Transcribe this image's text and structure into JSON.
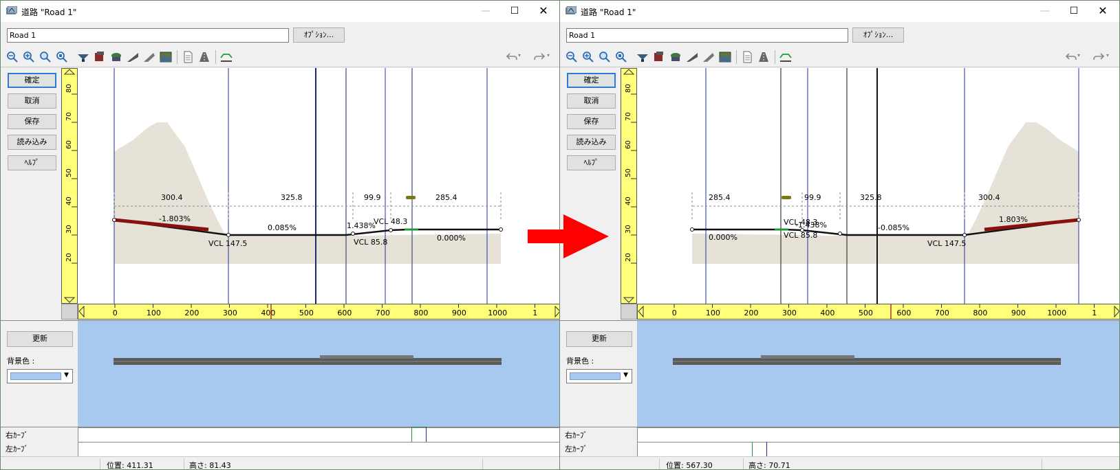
{
  "left_window": {
    "title": "道路 \"Road 1\"",
    "name_value": "Road 1",
    "options_label": "ｵﾌﾟｼｮﾝ...",
    "buttons": {
      "confirm": "確定",
      "cancel": "取消",
      "save": "保存",
      "load": "読み込み",
      "help": "ﾍﾙﾌﾟ"
    },
    "update_label": "更新",
    "bg_color_label": "背景色 :",
    "right_curve_label": "右ｶｰﾌﾞ",
    "left_curve_label": "左ｶｰﾌﾞ",
    "status_position": "位置: 411.31",
    "status_height": "高さ: 81.43",
    "segment_lengths": [
      "300.4",
      "325.8",
      "99.9",
      "285.4"
    ],
    "grade_labels": [
      "-1.803%",
      "0.085%",
      "1.438%",
      "0.000%"
    ],
    "vcl_labels": [
      "VCL  147.5",
      "VCL  85.8",
      "VCL  48.3"
    ]
  },
  "right_window": {
    "title": "道路 \"Road 1\"",
    "name_value": "Road 1",
    "options_label": "ｵﾌﾟｼｮﾝ...",
    "buttons": {
      "confirm": "確定",
      "cancel": "取消",
      "save": "保存",
      "load": "読み込み",
      "help": "ﾍﾙﾌﾟ"
    },
    "update_label": "更新",
    "bg_color_label": "背景色 :",
    "right_curve_label": "右ｶｰﾌﾞ",
    "left_curve_label": "左ｶｰﾌﾞ",
    "status_position": "位置: 567.30",
    "status_height": "高さ: 70.71",
    "segment_lengths": [
      "285.4",
      "99.9",
      "325.8",
      "300.4"
    ],
    "grade_labels": [
      "0.000%",
      "-1.438%",
      "-0.085%",
      "1.803%"
    ],
    "vcl_labels": [
      "VCL  48.3",
      "VCL  85.8",
      "VCL  147.5"
    ]
  },
  "rulers": {
    "x_ticks": [
      "0",
      "100",
      "200",
      "300",
      "400",
      "500",
      "600",
      "700",
      "800",
      "900",
      "1000",
      "1"
    ],
    "y_ticks": [
      "20",
      "30",
      "40",
      "50",
      "60",
      "70",
      "80"
    ]
  },
  "colors": {
    "ruler": "#ffff7a",
    "terrain": "#e6e2d8",
    "preview_bg": "#a7c8ef",
    "guide_line": "#1f2fa8",
    "arrow": "#ff0000"
  }
}
